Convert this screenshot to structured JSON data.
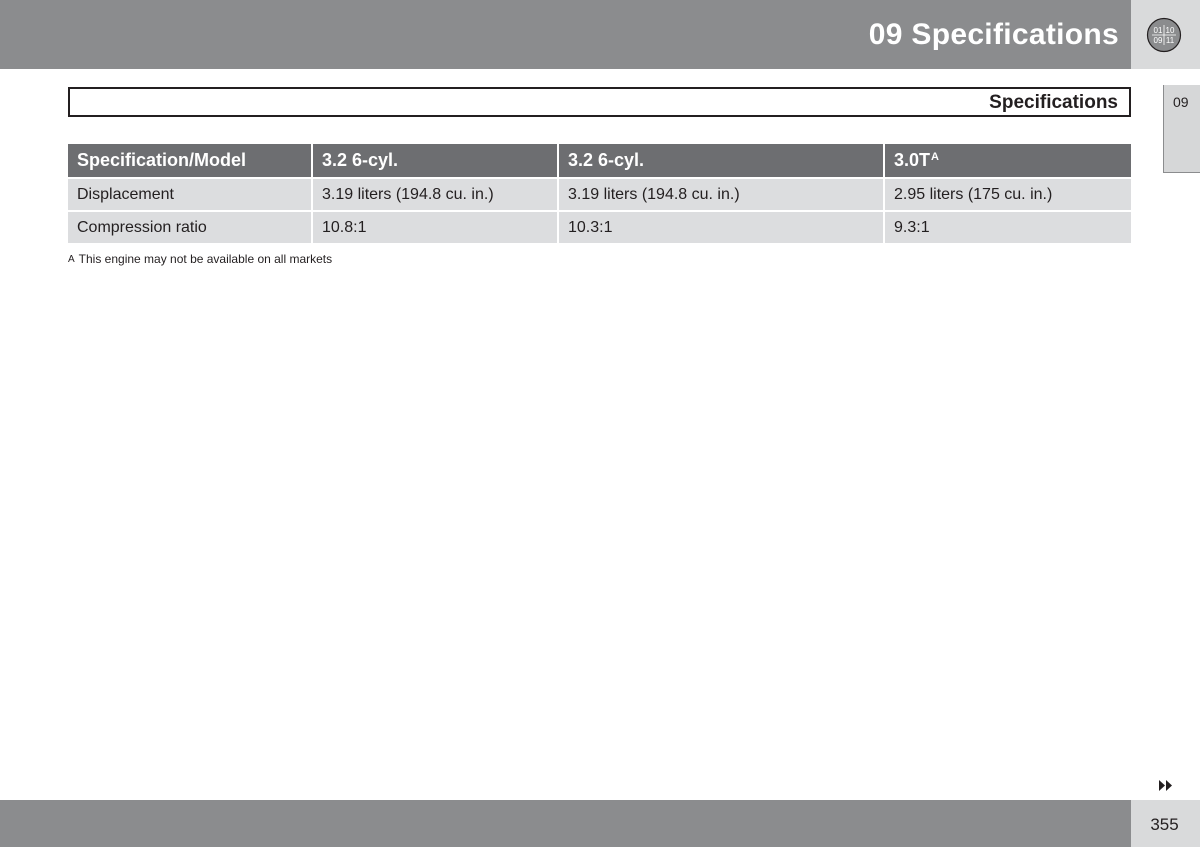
{
  "header": {
    "title": "09  Specifications",
    "chapter_icon": "chapter-numbers-icon",
    "icon_digits": [
      "01",
      "10",
      "09",
      "11"
    ]
  },
  "side_tab": {
    "label": "09"
  },
  "section": {
    "title": "Specifications"
  },
  "table": {
    "columns": [
      {
        "label": "Specification/Model",
        "sup": ""
      },
      {
        "label": "3.2 6-cyl.",
        "sup": ""
      },
      {
        "label": "3.2 6-cyl.",
        "sup": ""
      },
      {
        "label": "3.0T",
        "sup": "A"
      }
    ],
    "rows": [
      [
        "Displacement",
        "3.19 liters (194.8 cu. in.)",
        "3.19 liters (194.8 cu. in.)",
        "2.95 liters (175 cu. in.)"
      ],
      [
        "Compression ratio",
        "10.8:1",
        "10.3:1",
        "9.3:1"
      ]
    ]
  },
  "footnote": {
    "mark": "A",
    "text": "This engine may not be available on all markets"
  },
  "footer": {
    "page_number": "355",
    "next_icon": "double-arrow-right-icon"
  },
  "colors": {
    "header_bar": "#8b8c8e",
    "header_corner": "#d9dadb",
    "table_header": "#6d6e71",
    "table_cell": "#dcdddf"
  }
}
